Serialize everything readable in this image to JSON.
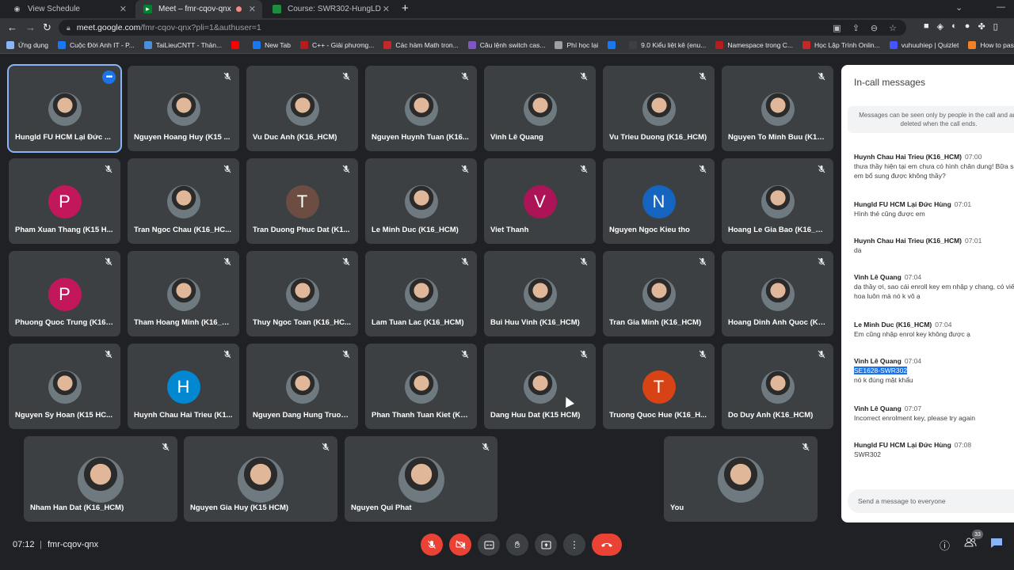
{
  "browser": {
    "tabs": [
      {
        "title": "View Schedule",
        "icon": "github-icon",
        "active": false
      },
      {
        "title": "Meet – fmr-cqov-qnx",
        "icon": "meet-icon",
        "active": true
      },
      {
        "title": "Course: SWR302-HungLD",
        "icon": "course-icon",
        "active": false
      }
    ],
    "new_tab": "+",
    "url_host": "meet.google.com",
    "url_path": "/fmr-cqov-qnx?pli=1&authuser=1",
    "bookmarks": [
      {
        "label": "Ứng dụng",
        "color": "#8ab4f8"
      },
      {
        "label": "Cuộc Đời Anh IT - P...",
        "color": "#1877f2"
      },
      {
        "label": "TaiLieuCNTT - Thản...",
        "color": "#4a90d9"
      },
      {
        "label": "",
        "color": "#ff0000"
      },
      {
        "label": "New Tab",
        "color": "#1877f2"
      },
      {
        "label": "C++ - Giải phương...",
        "color": "#b71c1c"
      },
      {
        "label": "Các hàm Math tron...",
        "color": "#c62828"
      },
      {
        "label": "Câu lệnh switch cas...",
        "color": "#7e57c2"
      },
      {
        "label": "Phí học lại",
        "color": "#9aa0a6"
      },
      {
        "label": "",
        "color": "#1877f2"
      },
      {
        "label": "9.0 Kiểu liệt kê (enu...",
        "color": "#3c4043"
      },
      {
        "label": "Namespace trong C...",
        "color": "#b71c1c"
      },
      {
        "label": "Học Lập Trình Onlin...",
        "color": "#c62828"
      },
      {
        "label": "vuhuuhiep | Quizlet",
        "color": "#4255ff"
      },
      {
        "label": "How to pass a 2D a...",
        "color": "#f48024"
      }
    ]
  },
  "participants": [
    {
      "name": "Hungld FU HCM Lại Đức ...",
      "avatar_type": "photo",
      "letter": "",
      "color": "#5f6368",
      "muted": false,
      "selected": true
    },
    {
      "name": "Nguyen Hoang Huy (K15 ...",
      "avatar_type": "photo",
      "letter": "",
      "color": "#5f6368",
      "muted": true
    },
    {
      "name": "Vu Duc Anh (K16_HCM)",
      "avatar_type": "photo",
      "letter": "",
      "color": "#5f6368",
      "muted": true
    },
    {
      "name": "Nguyen Huynh Tuan (K16...",
      "avatar_type": "photo",
      "letter": "",
      "color": "#5f6368",
      "muted": true
    },
    {
      "name": "Vinh Lê Quang",
      "avatar_type": "photo",
      "letter": "",
      "color": "#5f6368",
      "muted": true
    },
    {
      "name": "Vu Trieu Duong (K16_HCM)",
      "avatar_type": "photo",
      "letter": "",
      "color": "#5f6368",
      "muted": true
    },
    {
      "name": "Nguyen To Minh Buu (K16...",
      "avatar_type": "photo",
      "letter": "",
      "color": "#5f6368",
      "muted": true
    },
    {
      "name": "Pham Xuan Thang (K15 H...",
      "avatar_type": "letter",
      "letter": "P",
      "color": "#c2185b",
      "muted": true
    },
    {
      "name": "Tran Ngoc Chau (K16_HC...",
      "avatar_type": "photo",
      "letter": "",
      "color": "#5f6368",
      "muted": true
    },
    {
      "name": "Tran Duong Phuc Dat (K1...",
      "avatar_type": "letter",
      "letter": "T",
      "color": "#6d4c41",
      "muted": true
    },
    {
      "name": "Le Minh Duc (K16_HCM)",
      "avatar_type": "photo",
      "letter": "",
      "color": "#5f6368",
      "muted": true
    },
    {
      "name": "Viet Thanh",
      "avatar_type": "letter",
      "letter": "V",
      "color": "#ad1457",
      "muted": true
    },
    {
      "name": "Nguyen Ngoc Kieu tho",
      "avatar_type": "letter",
      "letter": "N",
      "color": "#1565c0",
      "muted": true
    },
    {
      "name": "Hoang Le Gia Bao (K16_H...",
      "avatar_type": "photo",
      "letter": "",
      "color": "#5f6368",
      "muted": true
    },
    {
      "name": "Phuong Quoc Trung (K16_...",
      "avatar_type": "letter",
      "letter": "P",
      "color": "#c2185b",
      "muted": true
    },
    {
      "name": "Tham Hoang Minh (K16_H...",
      "avatar_type": "photo",
      "letter": "",
      "color": "#5f6368",
      "muted": true
    },
    {
      "name": "Thuy Ngoc Toan (K16_HC...",
      "avatar_type": "photo",
      "letter": "",
      "color": "#5f6368",
      "muted": true
    },
    {
      "name": "Lam Tuan Lac (K16_HCM)",
      "avatar_type": "photo",
      "letter": "",
      "color": "#5f6368",
      "muted": true
    },
    {
      "name": "Bui Huu Vinh (K16_HCM)",
      "avatar_type": "photo",
      "letter": "",
      "color": "#5f6368",
      "muted": true
    },
    {
      "name": "Tran Gia Minh (K16_HCM)",
      "avatar_type": "photo",
      "letter": "",
      "color": "#5f6368",
      "muted": true
    },
    {
      "name": "Hoang Dinh Anh Quoc (K1...",
      "avatar_type": "photo",
      "letter": "",
      "color": "#5f6368",
      "muted": true
    },
    {
      "name": "Nguyen Sy Hoan (K15 HC...",
      "avatar_type": "photo",
      "letter": "",
      "color": "#5f6368",
      "muted": true
    },
    {
      "name": "Huynh Chau Hai Trieu (K1...",
      "avatar_type": "letter",
      "letter": "H",
      "color": "#0288d1",
      "muted": true
    },
    {
      "name": "Nguyen Dang Hung Truon...",
      "avatar_type": "photo",
      "letter": "",
      "color": "#5f6368",
      "muted": true
    },
    {
      "name": "Phan Thanh Tuan Kiet (K1...",
      "avatar_type": "photo",
      "letter": "",
      "color": "#5f6368",
      "muted": true
    },
    {
      "name": "Dang Huu Dat (K15 HCM)",
      "avatar_type": "photo",
      "letter": "",
      "color": "#5f6368",
      "muted": true
    },
    {
      "name": "Truong Quoc Hue (K16_H...",
      "avatar_type": "letter",
      "letter": "T",
      "color": "#d84315",
      "muted": true
    },
    {
      "name": "Do Duy Anh (K16_HCM)",
      "avatar_type": "photo",
      "letter": "",
      "color": "#5f6368",
      "muted": true
    },
    {
      "name": "Nham Han Dat (K16_HCM)",
      "avatar_type": "photo",
      "letter": "",
      "color": "#5f6368",
      "muted": true
    },
    {
      "name": "Nguyen Gia Huy (K15 HCM)",
      "avatar_type": "photo",
      "letter": "",
      "color": "#5f6368",
      "muted": true
    },
    {
      "name": "Nguyen Qui Phat",
      "avatar_type": "photo",
      "letter": "",
      "color": "#5f6368",
      "muted": true
    },
    {
      "name": "You",
      "avatar_type": "photo",
      "letter": "",
      "color": "#5f6368",
      "muted": true
    }
  ],
  "chat": {
    "title": "In-call messages",
    "notice": "Messages can be seen only by people in the call and are deleted when the call ends.",
    "messages": [
      {
        "sender": "Huynh Chau Hai Trieu (K16_HCM)",
        "time": "07:00",
        "text": "thưa thầy hiện tại em chưa có hình chân dung! Bữa sau em bổ sung được không thầy?"
      },
      {
        "sender": "Hungld FU HCM Lại Đức Hùng",
        "time": "07:01",
        "text": "Hình thẻ cũng được em"
      },
      {
        "sender": "Huynh Chau Hai Trieu (K16_HCM)",
        "time": "07:01",
        "text": "dạ"
      },
      {
        "sender": "Vinh Lê Quang",
        "time": "07:04",
        "text": "dạ thầy ơi, sao cái enroll key em nhập y chang, có viết hoa luôn mà nó k vô ạ"
      },
      {
        "sender": "Le Minh Duc (K16_HCM)",
        "time": "07:04",
        "text": "Em cũng nhập enrol key không được ạ"
      },
      {
        "sender": "Vinh Lê Quang",
        "time": "07:04",
        "highlight": "SE1628-SWR302",
        "text": "nó k đúng mặt khẩu"
      },
      {
        "sender": "Vinh Lê Quang",
        "time": "07:07",
        "text": "Incorrect enrolment key, please try again"
      },
      {
        "sender": "Hungld FU HCM Lại Đức Hùng",
        "time": "07:08",
        "text": "SWR302"
      }
    ],
    "input_placeholder": "Send a message to everyone"
  },
  "bottom": {
    "time": "07:12",
    "separator": "|",
    "meeting_code": "fmr-cqov-qnx",
    "participants_count": "33"
  }
}
